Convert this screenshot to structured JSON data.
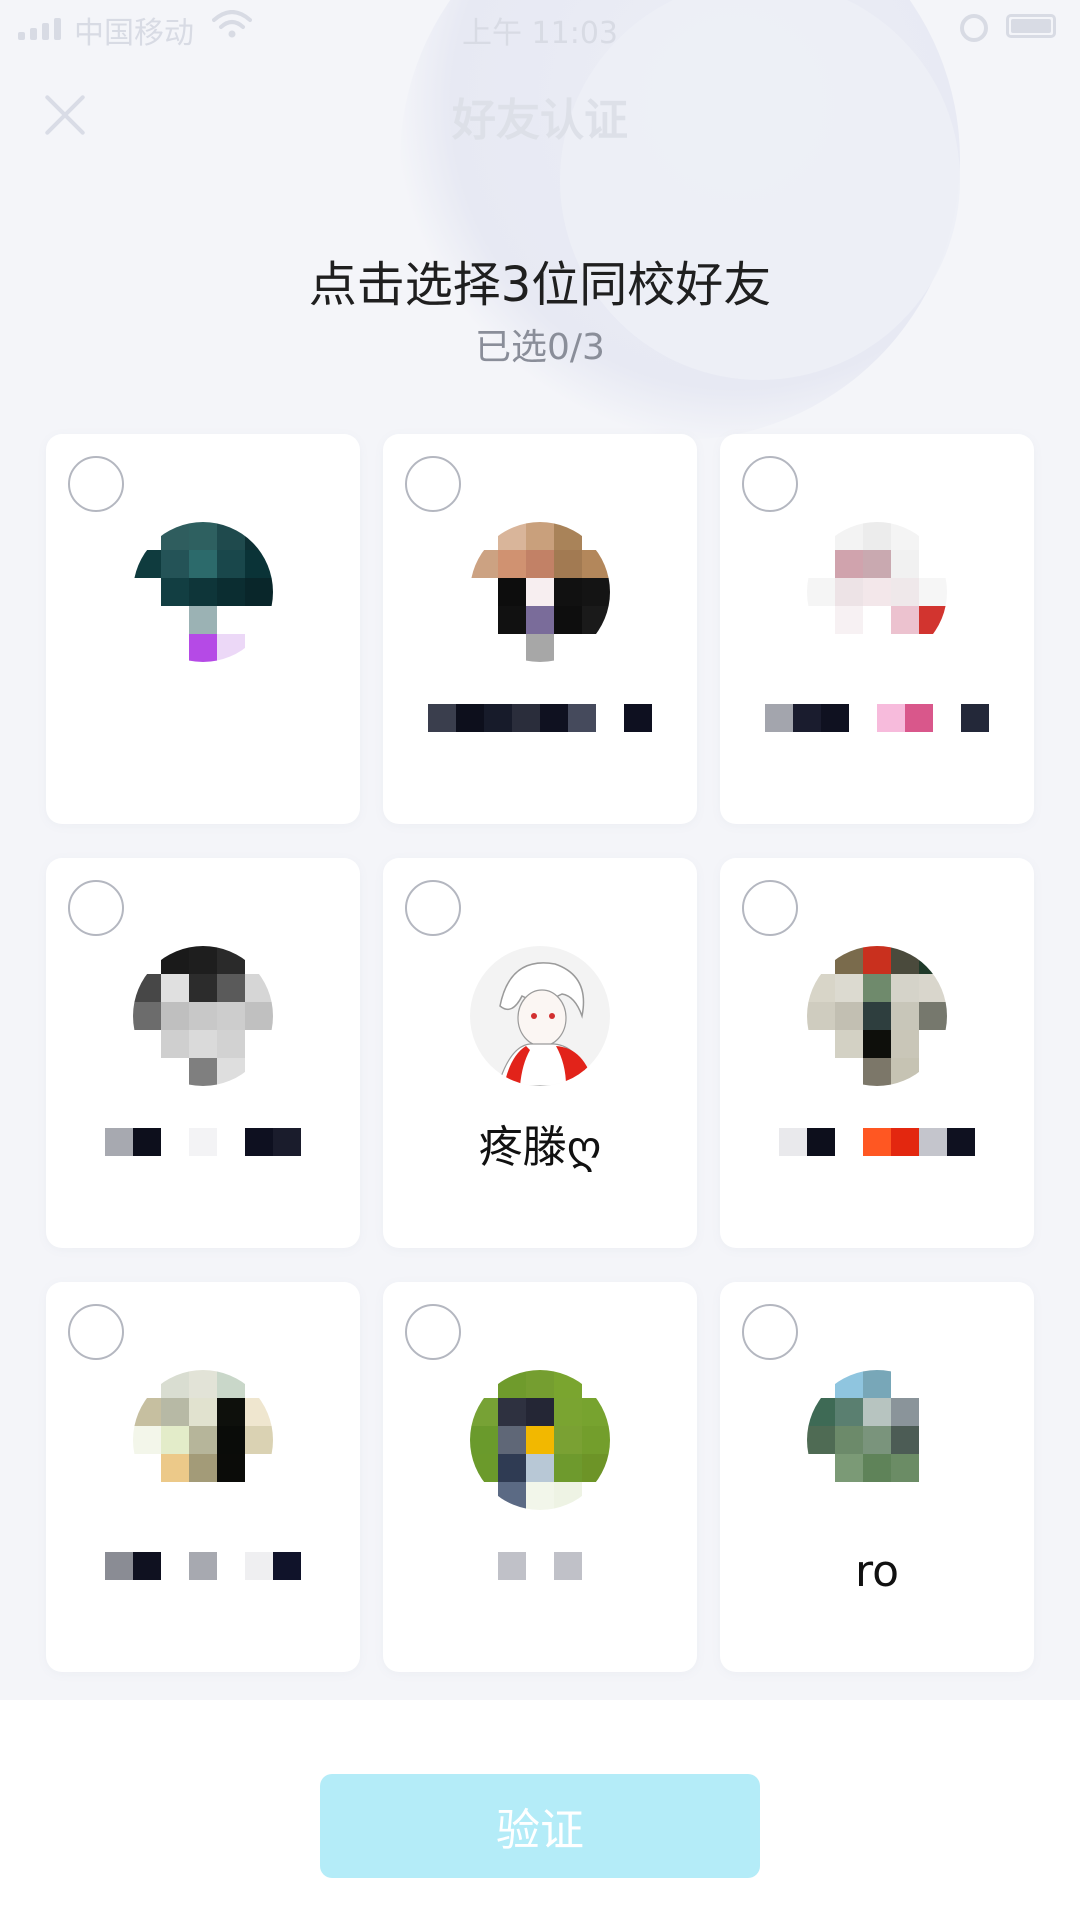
{
  "status_bar": {
    "carrier": "中国移动",
    "time": "上午 11:03"
  },
  "nav": {
    "title": "好友认证",
    "close_icon": "close-icon"
  },
  "header": {
    "title": "点击选择3位同校好友",
    "selection_count": "已选0/3"
  },
  "cards": [
    {
      "name": "",
      "selected": false,
      "avatar_colors": [
        "#ffffff",
        "#2f5d5e",
        "#2e6060",
        "#1f4a4d",
        "#0d2f33",
        "#0f3b3e",
        "#245357",
        "#2c6a6b",
        "#19474b",
        "#0a3337",
        "#ffffff",
        "#123e42",
        "#0e3539",
        "#0b2d31",
        "#09262a",
        "#ffffff",
        "#ffffff",
        "#9bb2b4",
        "#ffffff",
        "#ffffff",
        "#ffffff",
        "#ffffff",
        "#b54ae6",
        "#ecd8f7",
        "#ffffff"
      ],
      "name_colors": []
    },
    {
      "name": "",
      "selected": false,
      "avatar_colors": [
        "#ffffff",
        "#d9b59a",
        "#c9a07c",
        "#a98359",
        "#ffffff",
        "#cca282",
        "#d09271",
        "#c28166",
        "#a27a52",
        "#b3875b",
        "#ffffff",
        "#0d0d0d",
        "#f7eef0",
        "#111111",
        "#141414",
        "#ffffff",
        "#111111",
        "#7a6c9a",
        "#0e0e0e",
        "#1a1a1a",
        "#ffffff",
        "#ffffff",
        "#a7a7a7",
        "#ffffff",
        "#ffffff"
      ],
      "name_colors": [
        "#3a3e4d",
        "#0d0f1c",
        "#171b2a",
        "#2a2d3b",
        "#0f1120",
        "#454a5c",
        "#ffffff",
        "#0e1020"
      ]
    },
    {
      "name": "",
      "selected": false,
      "avatar_colors": [
        "#ffffff",
        "#f3f3f3",
        "#ececec",
        "#f4f4f4",
        "#ffffff",
        "#ffffff",
        "#d0a3ad",
        "#c9a9b0",
        "#f1f1f1",
        "#ffffff",
        "#f5f5f5",
        "#ede3e6",
        "#f3e7ea",
        "#efe8ea",
        "#f6f6f6",
        "#ffffff",
        "#f7f1f3",
        "#ffffff",
        "#ecc2cf",
        "#d2342f",
        "#ffffff",
        "#ffffff",
        "#ffffff",
        "#ffffff",
        "#ffffff"
      ],
      "name_colors": [
        "#a3a5ad",
        "#1a1c2e",
        "#0f1120",
        "#ffffff",
        "#f7bbdc",
        "#d9578b",
        "#ffffff",
        "#232839"
      ]
    },
    {
      "name": "",
      "selected": false,
      "avatar_colors": [
        "#ffffff",
        "#1a1a1a",
        "#1e1e1e",
        "#2a2a2a",
        "#ffffff",
        "#474747",
        "#e0e0e0",
        "#2c2c2c",
        "#5a5a5a",
        "#d6d6d6",
        "#6c6c6c",
        "#bfbfbf",
        "#c8c8c8",
        "#cdcdcd",
        "#c0c0c0",
        "#ffffff",
        "#cfcfcf",
        "#dadada",
        "#d2d2d2",
        "#ffffff",
        "#ffffff",
        "#ffffff",
        "#7f7f7f",
        "#dedede",
        "#ffffff"
      ],
      "name_colors": [
        "#a7a9b0",
        "#0d0f1c",
        "#ffffff",
        "#f3f3f5",
        "#ffffff",
        "#0e1020",
        "#1a1c2c"
      ]
    },
    {
      "name": "疼滕ღ",
      "selected": false,
      "avatar_colors": [],
      "name_colors": []
    },
    {
      "name": "",
      "selected": false,
      "avatar_colors": [
        "#ffffff",
        "#7a6b4c",
        "#c9301e",
        "#4a4a3c",
        "#1f3a2a",
        "#d8d5c8",
        "#dcdad0",
        "#6f8a6c",
        "#d5d3c9",
        "#d9d6cc",
        "#cfccbf",
        "#c2bfb2",
        "#2e3e3e",
        "#c8c6b9",
        "#76786d",
        "#ffffff",
        "#d3d1c4",
        "#0e0f0b",
        "#c9c6b8",
        "#ffffff",
        "#ffffff",
        "#ffffff",
        "#7c7769",
        "#c6c3b3",
        "#ffffff"
      ],
      "name_colors": [
        "#e9e9ec",
        "#0d0f1c",
        "#ffffff",
        "#ff5722",
        "#e3270f",
        "#c4c5cc",
        "#0f1120"
      ]
    },
    {
      "name": "",
      "selected": false,
      "avatar_colors": [
        "#ffffff",
        "#d9ddd1",
        "#e2e3d7",
        "#c9d7c9",
        "#ffffff",
        "#c6bfa0",
        "#b7b9a5",
        "#e1e2cf",
        "#0e100c",
        "#efe6cf",
        "#f3f6ea",
        "#e3ecc9",
        "#b6b59a",
        "#0a0c09",
        "#dad2b3",
        "#ffffff",
        "#ecc989",
        "#a39b78",
        "#0b0c09",
        "#ffffff",
        "#ffffff",
        "#ffffff",
        "#ffffff",
        "#ffffff",
        "#ffffff"
      ],
      "name_colors": [
        "#8a8c94",
        "#0f1120",
        "#ffffff",
        "#a7a9b0",
        "#ffffff",
        "#efeff1",
        "#10132a"
      ]
    },
    {
      "name": "",
      "selected": false,
      "avatar_colors": [
        "#ffffff",
        "#6f9b2c",
        "#759e30",
        "#7aa52f",
        "#ffffff",
        "#77a235",
        "#2e3140",
        "#242635",
        "#7aa431",
        "#77a32f",
        "#6a9a2c",
        "#5f6777",
        "#f2b800",
        "#7aa133",
        "#739e2c",
        "#6b9a2b",
        "#2f3b53",
        "#b8c8d6",
        "#6e9a2d",
        "#6d9427",
        "#ffffff",
        "#5b6a84",
        "#f2f6ea",
        "#eef3e4",
        "#ffffff"
      ],
      "name_colors": [
        "#c0c1c8",
        "#ffffff",
        "#c0c1c8"
      ]
    },
    {
      "name": "ro",
      "selected": false,
      "avatar_colors": [
        "#ffffff",
        "#8fc5df",
        "#78a7b8",
        "#ffffff",
        "#ffffff",
        "#3e6a55",
        "#5a7f70",
        "#b7c4c0",
        "#8a949a",
        "#ffffff",
        "#4f6b54",
        "#6c8a6a",
        "#7a947c",
        "#4c5c55",
        "#ffffff",
        "#ffffff",
        "#7b9a76",
        "#5f8359",
        "#6b8c65",
        "#ffffff",
        "#ffffff",
        "#ffffff",
        "#ffffff",
        "#ffffff",
        "#ffffff"
      ],
      "name_colors": []
    }
  ],
  "verify_button": {
    "label": "验证",
    "color": "#b4ecf8"
  }
}
